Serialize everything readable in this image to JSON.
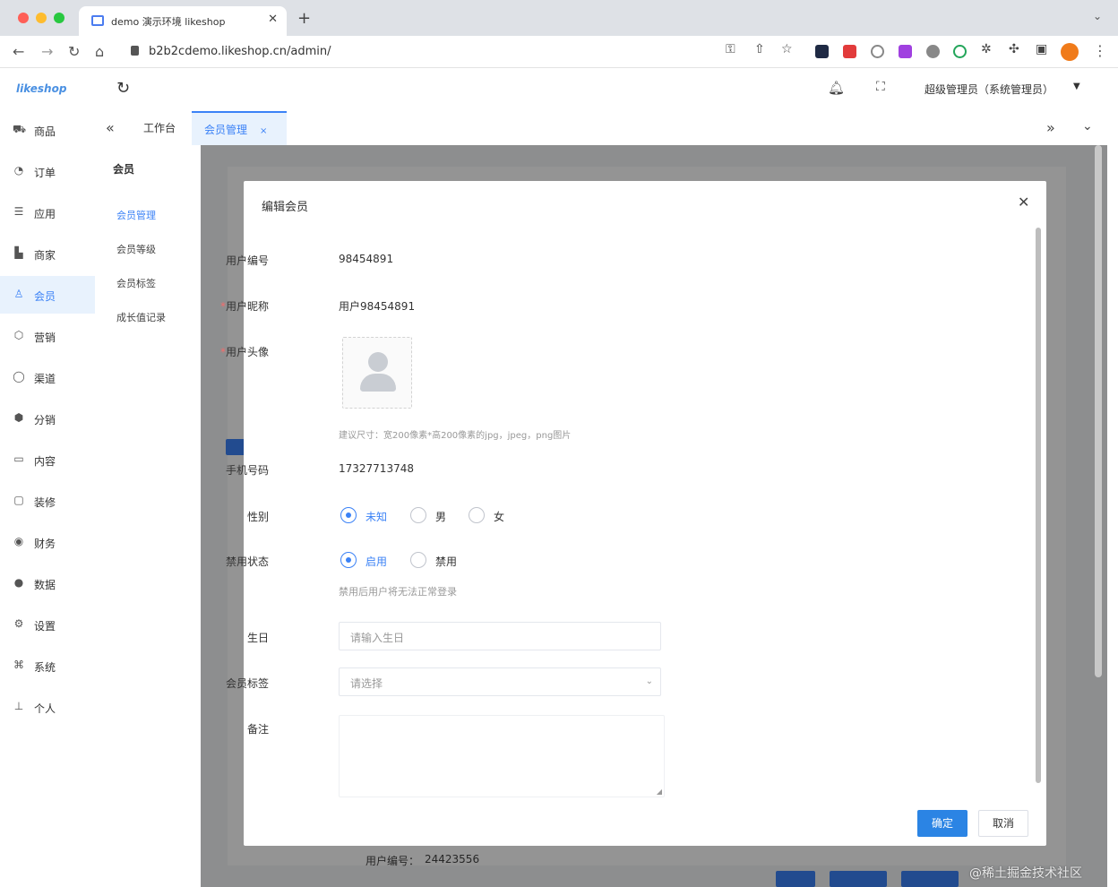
{
  "browser": {
    "tab_title": "demo 演示环境 likeshop",
    "new_tab": "+",
    "url": "b2b2cdemo.likeshop.cn/admin/"
  },
  "app": {
    "logo": "likeshop",
    "admin_name": "超级管理员（系统管理员）"
  },
  "sidebar": {
    "items": [
      {
        "icon": "cart-icon",
        "glyph": "⛟",
        "label": "商品"
      },
      {
        "icon": "order-icon",
        "glyph": "◔",
        "label": "订单"
      },
      {
        "icon": "apps-icon",
        "glyph": "☰",
        "label": "应用"
      },
      {
        "icon": "shop-icon",
        "glyph": "▙",
        "label": "商家"
      },
      {
        "icon": "user-icon",
        "glyph": "♙",
        "label": "会员"
      },
      {
        "icon": "marketing-icon",
        "glyph": "⬡",
        "label": "营销"
      },
      {
        "icon": "channel-icon",
        "glyph": "◯",
        "label": "渠道"
      },
      {
        "icon": "distribution-icon",
        "glyph": "⬢",
        "label": "分销"
      },
      {
        "icon": "content-icon",
        "glyph": "▭",
        "label": "内容"
      },
      {
        "icon": "decoration-icon",
        "glyph": "▢",
        "label": "装修"
      },
      {
        "icon": "finance-icon",
        "glyph": "◉",
        "label": "财务"
      },
      {
        "icon": "data-icon",
        "glyph": "●",
        "label": "数据"
      },
      {
        "icon": "settings-icon",
        "glyph": "⚙",
        "label": "设置"
      },
      {
        "icon": "system-icon",
        "glyph": "⌘",
        "label": "系统"
      },
      {
        "icon": "personal-icon",
        "glyph": "⊥",
        "label": "个人"
      }
    ]
  },
  "tabs": {
    "home": "工作台",
    "active": "会员管理",
    "close": "×"
  },
  "submenu": {
    "title": "会员",
    "items": [
      "会员管理",
      "会员等级",
      "会员标签",
      "成长值记录"
    ]
  },
  "background": {
    "user_no_label": "用户编号：",
    "user_no_value": "24423556"
  },
  "dialog": {
    "title": "编辑会员",
    "user_no_label": "用户编号",
    "user_no": "98454891",
    "nickname_label": "用户昵称",
    "nickname": "用户98454891",
    "avatar_label": "用户头像",
    "avatar_hint": "建议尺寸：宽200像素*高200像素的jpg，jpeg，png图片",
    "phone_label": "手机号码",
    "phone": "17327713748",
    "gender_label": "性别",
    "gender_options": [
      "未知",
      "男",
      "女"
    ],
    "gender_selected": "未知",
    "status_label": "禁用状态",
    "status_options": [
      "启用",
      "禁用"
    ],
    "status_selected": "启用",
    "status_hint": "禁用后用户将无法正常登录",
    "birthday_label": "生日",
    "birthday_placeholder": "请输入生日",
    "tag_label": "会员标签",
    "tag_placeholder": "请选择",
    "remark_label": "备注",
    "confirm": "确定",
    "cancel": "取消"
  },
  "watermark": "@稀土掘金技术社区",
  "colors": {
    "accent": "#3b82f6",
    "primary_button": "#2b84e4",
    "active_bg": "#e8f2fd"
  }
}
